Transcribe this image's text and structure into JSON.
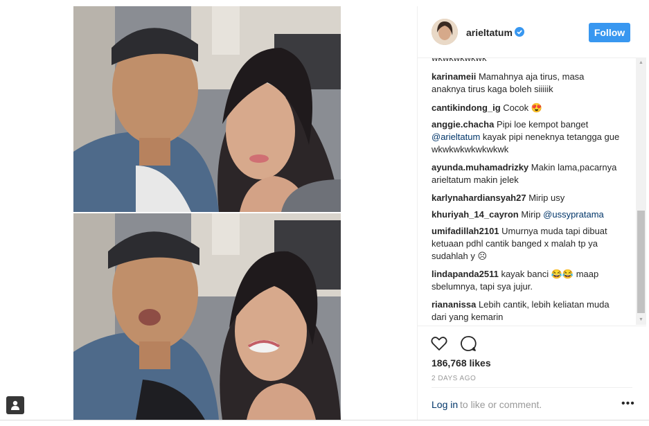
{
  "post": {
    "username": "arieltatum",
    "follow_label": "Follow",
    "cut_comment": "wkwkwkwkwk",
    "comments": [
      {
        "user": "karinameii",
        "parts": [
          {
            "t": "text",
            "v": "Mamahnya aja tirus, masa anaknya tirus kaga boleh siiiiik"
          }
        ]
      },
      {
        "user": "cantikindong_ig",
        "parts": [
          {
            "t": "text",
            "v": "Cocok 😍"
          }
        ]
      },
      {
        "user": "anggie.chacha",
        "parts": [
          {
            "t": "text",
            "v": "Pipi loe kempot banget "
          },
          {
            "t": "mention",
            "v": "@arieltatum"
          },
          {
            "t": "text",
            "v": " kayak pipi neneknya tetangga gue wkwkwkwkwkwkwk"
          }
        ]
      },
      {
        "user": "ayunda.muhamadrizky",
        "parts": [
          {
            "t": "text",
            "v": "Makin lama,pacarnya arieltatum makin jelek"
          }
        ]
      },
      {
        "user": "karlynahardiansyah27",
        "parts": [
          {
            "t": "text",
            "v": "Mirip usy"
          }
        ]
      },
      {
        "user": "khuriyah_14_cayron",
        "parts": [
          {
            "t": "text",
            "v": "Mirip "
          },
          {
            "t": "mention",
            "v": "@ussypratama"
          }
        ]
      },
      {
        "user": "umifadillah2101",
        "parts": [
          {
            "t": "text",
            "v": "Umurnya muda tapi dibuat ketuaan pdhl cantik banged x malah tp ya sudahlah y ☹"
          }
        ]
      },
      {
        "user": "lindapanda2511",
        "parts": [
          {
            "t": "text",
            "v": "kayak banci 😂😂 maap sbelumnya, tapi sya jujur."
          }
        ]
      },
      {
        "user": "riananissa",
        "parts": [
          {
            "t": "text",
            "v": "Lebih cantik, lebih keliatan muda dari yang kemarin"
          }
        ]
      }
    ],
    "likes": "186,768 likes",
    "timestamp": "2 DAYS AGO",
    "login_link": "Log in",
    "login_text": " to like or comment.",
    "more_label": "•••"
  },
  "icons": {
    "verified": "verified-badge-icon",
    "heart": "heart-icon",
    "comment": "comment-bubble-icon",
    "user_tag": "user-tag-icon",
    "more": "more-options-icon"
  },
  "colors": {
    "accent": "#3897f0",
    "link": "#003569",
    "muted": "#999999"
  }
}
